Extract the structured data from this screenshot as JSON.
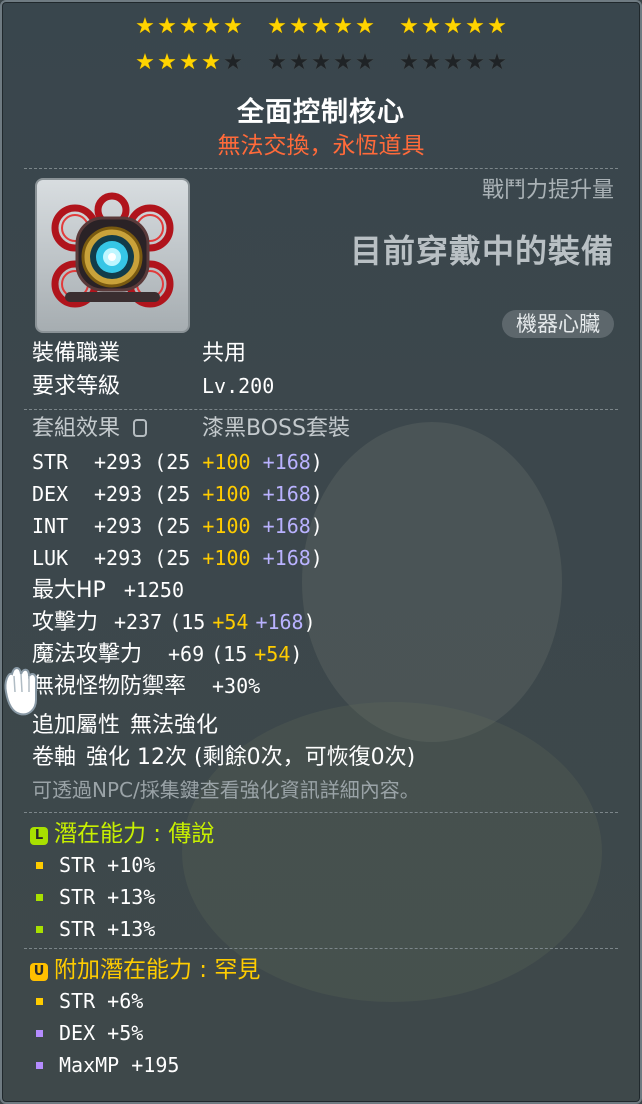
{
  "stars": {
    "rows": [
      {
        "groups": [
          5,
          5,
          5
        ],
        "filled": [
          5,
          5,
          5
        ]
      },
      {
        "groups": [
          5,
          5,
          5
        ],
        "filled": [
          4,
          0,
          0
        ]
      }
    ],
    "colors": {
      "on": "#ffd400",
      "off": "#1f2326"
    }
  },
  "item": {
    "name": "全面控制核心",
    "trade_note": "無法交換，永恆道具",
    "combat_power_label": "戰鬥力提升量",
    "equipped_label": "目前穿戴中的裝備",
    "type_badge": "機器心臟"
  },
  "requirements": {
    "job_label": "裝備職業",
    "job_value": "共用",
    "level_label": "要求等級",
    "level_value": "Lv.200"
  },
  "set_effect": {
    "label": "套組效果",
    "lock_icon": "lock-icon",
    "value": "漆黑BOSS套裝"
  },
  "stats": [
    {
      "name": "STR",
      "total": "+293",
      "base": "(25",
      "bonus": "+100",
      "star": "+168",
      "close": ")"
    },
    {
      "name": "DEX",
      "total": "+293",
      "base": "(25",
      "bonus": "+100",
      "star": "+168",
      "close": ")"
    },
    {
      "name": "INT",
      "total": "+293",
      "base": "(25",
      "bonus": "+100",
      "star": "+168",
      "close": ")"
    },
    {
      "name": "LUK",
      "total": "+293",
      "base": "(25",
      "bonus": "+100",
      "star": "+168",
      "close": ")"
    }
  ],
  "extra_stats": {
    "hp": {
      "name": "最大HP",
      "value": "+1250"
    },
    "att": {
      "name": "攻擊力",
      "total": "+237",
      "base": "(15",
      "bonus": "+54",
      "star": "+168",
      "close": ")"
    },
    "matt": {
      "name": "魔法攻擊力",
      "total": "+69",
      "base": "(15",
      "bonus": "+54",
      "close": ")"
    },
    "ied": {
      "name": "無視怪物防禦率",
      "value": "+30%"
    }
  },
  "enhance": {
    "flame_label": "追加屬性",
    "flame_value": "無法強化",
    "scroll_label": "卷軸",
    "scroll_value": "強化 12次 (剩餘0次，可恢復0次)",
    "hint": "可透過NPC/採集鍵查看強化資訊詳細內容。"
  },
  "potential": {
    "icon_letter": "L",
    "icon_color": "#a8e000",
    "title": "潛在能力 : 傳說",
    "title_color": "#c8f000",
    "lines": [
      {
        "text": "STR +10%",
        "bullet_color": "#ffcc00"
      },
      {
        "text": "STR +13%",
        "bullet_color": "#a8e000"
      },
      {
        "text": "STR +13%",
        "bullet_color": "#a8e000"
      }
    ]
  },
  "additional_potential": {
    "icon_letter": "U",
    "icon_color": "#ffc000",
    "title": "附加潛在能力 : 罕見",
    "title_color": "#ffcc00",
    "lines": [
      {
        "text": "STR +6%",
        "bullet_color": "#ffcc00"
      },
      {
        "text": "DEX +5%",
        "bullet_color": "#b58cff"
      },
      {
        "text": "MaxMP +195",
        "bullet_color": "#b58cff"
      }
    ]
  }
}
